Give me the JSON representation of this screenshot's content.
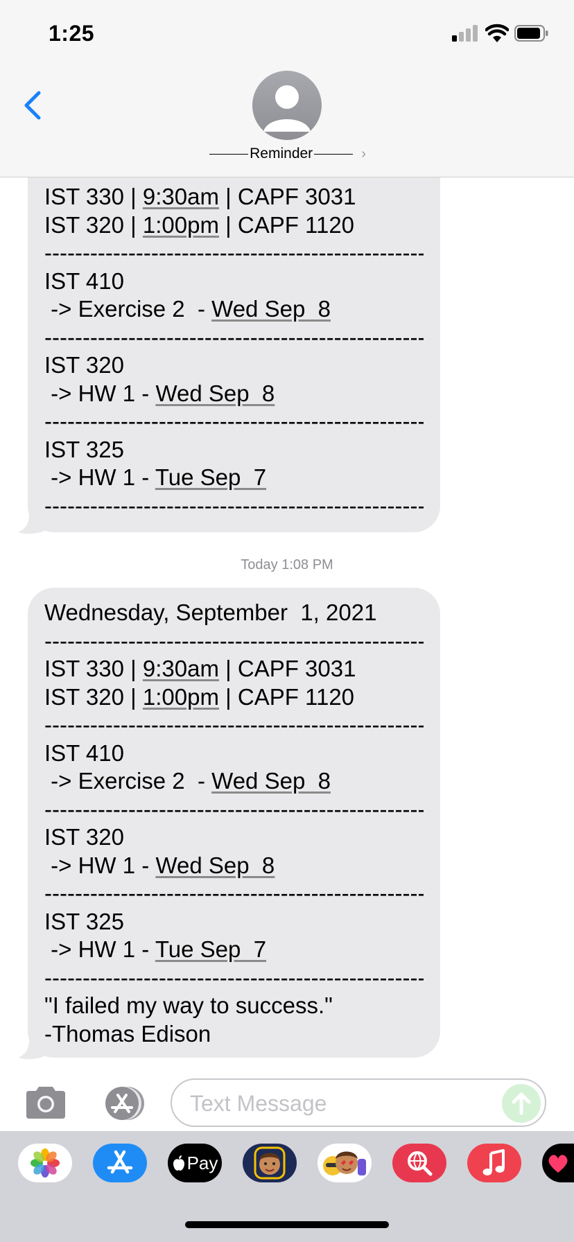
{
  "status_bar": {
    "time": "1:25"
  },
  "header": {
    "contact_name": "Reminder"
  },
  "messages": [
    {
      "lines": [
        {
          "parts": [
            {
              "t": "IST 330 | "
            },
            {
              "t": "9:30am",
              "u": true
            },
            {
              "t": " | CAPF 3031"
            }
          ]
        },
        {
          "parts": [
            {
              "t": "IST 320 | "
            },
            {
              "t": "1:00pm",
              "u": true
            },
            {
              "t": " | CAPF 1120"
            }
          ]
        },
        {
          "parts": [
            {
              "t": "--------------------------------------------------"
            }
          ],
          "dash": true
        },
        {
          "parts": [
            {
              "t": "IST 410"
            }
          ]
        },
        {
          "parts": [
            {
              "t": " -> Exercise 2  - "
            },
            {
              "t": "Wed Sep  8",
              "u": true
            }
          ]
        },
        {
          "parts": [
            {
              "t": "--------------------------------------------------"
            }
          ],
          "dash": true
        },
        {
          "parts": [
            {
              "t": "IST 320"
            }
          ]
        },
        {
          "parts": [
            {
              "t": " -> HW 1 - "
            },
            {
              "t": "Wed Sep  8",
              "u": true
            }
          ]
        },
        {
          "parts": [
            {
              "t": "--------------------------------------------------"
            }
          ],
          "dash": true
        },
        {
          "parts": [
            {
              "t": "IST 325"
            }
          ]
        },
        {
          "parts": [
            {
              "t": " -> HW 1 - "
            },
            {
              "t": "Tue Sep  7",
              "u": true
            }
          ]
        },
        {
          "parts": [
            {
              "t": "--------------------------------------------------"
            }
          ],
          "dash": true
        }
      ]
    },
    {
      "lines": [
        {
          "parts": [
            {
              "t": "Wednesday, September  1, 2021"
            }
          ]
        },
        {
          "parts": [
            {
              "t": "--------------------------------------------------"
            }
          ],
          "dash": true
        },
        {
          "parts": [
            {
              "t": "IST 330 | "
            },
            {
              "t": "9:30am",
              "u": true
            },
            {
              "t": " | CAPF 3031"
            }
          ]
        },
        {
          "parts": [
            {
              "t": "IST 320 | "
            },
            {
              "t": "1:00pm",
              "u": true
            },
            {
              "t": " | CAPF 1120"
            }
          ]
        },
        {
          "parts": [
            {
              "t": "--------------------------------------------------"
            }
          ],
          "dash": true
        },
        {
          "parts": [
            {
              "t": "IST 410"
            }
          ]
        },
        {
          "parts": [
            {
              "t": " -> Exercise 2  - "
            },
            {
              "t": "Wed Sep  8",
              "u": true
            }
          ]
        },
        {
          "parts": [
            {
              "t": "--------------------------------------------------"
            }
          ],
          "dash": true
        },
        {
          "parts": [
            {
              "t": "IST 320"
            }
          ]
        },
        {
          "parts": [
            {
              "t": " -> HW 1 - "
            },
            {
              "t": "Wed Sep  8",
              "u": true
            }
          ]
        },
        {
          "parts": [
            {
              "t": "--------------------------------------------------"
            }
          ],
          "dash": true
        },
        {
          "parts": [
            {
              "t": "IST 325"
            }
          ]
        },
        {
          "parts": [
            {
              "t": " -> HW 1 - "
            },
            {
              "t": "Tue Sep  7",
              "u": true
            }
          ]
        },
        {
          "parts": [
            {
              "t": "--------------------------------------------------"
            }
          ],
          "dash": true
        },
        {
          "parts": [
            {
              "t": "\"I failed my way to success.\""
            }
          ]
        },
        {
          "parts": [
            {
              "t": "-Thomas Edison"
            }
          ]
        }
      ]
    }
  ],
  "timestamp": {
    "label": "Today",
    "time": "1:08 PM"
  },
  "composer": {
    "placeholder": "Text Message"
  },
  "app_tray": {
    "apple_pay_label": "Pay",
    "icons": [
      "photos-icon",
      "app-store-icon",
      "apple-pay-icon",
      "memoji-icon",
      "memoji-stickers-icon",
      "web-search-icon",
      "music-icon",
      "heart-app-icon"
    ]
  },
  "colors": {
    "accent_blue": "#1a82fb",
    "bubble_gray": "#e9e9eb",
    "send_green": "#d5f2d6",
    "music_red": "#f0414f",
    "search_red": "#e8384f"
  }
}
